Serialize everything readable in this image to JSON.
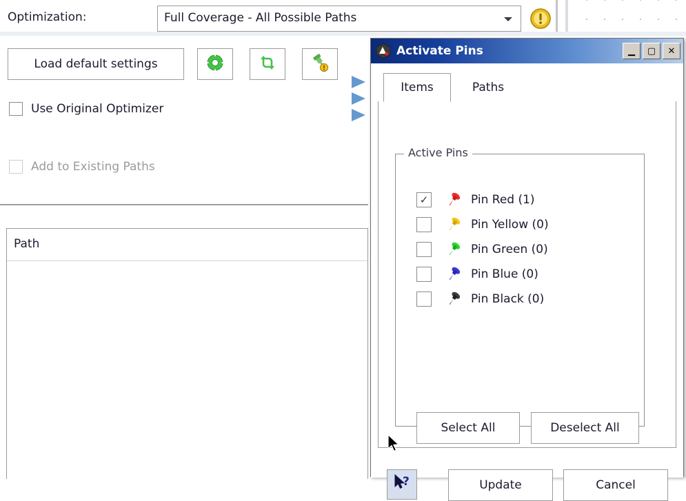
{
  "background": {
    "optimization": {
      "label": "Optimization:",
      "combo_value": "Full Coverage - All Possible Paths",
      "combo_arrow_icon": "chevron-down-icon",
      "warning_icon": "warning-exclamation-icon"
    },
    "toolbar": {
      "load_defaults_label": "Load default settings",
      "gear_icon": "gear-icon",
      "sync_icon": "sync-refresh-icon",
      "pin_icon": "pin-warning-icon",
      "ribbon_icon": "blue-chevron-icon"
    },
    "options": [
      {
        "label": "Use Original Optimizer",
        "checked": false,
        "disabled": false
      },
      {
        "label": "Add to Existing Paths",
        "checked": false,
        "disabled": true
      }
    ],
    "path_table": {
      "column_header": "Path",
      "rows": []
    }
  },
  "dialog": {
    "title": "Activate Pins",
    "app_icon": "app-hexagon-icon",
    "window_buttons": {
      "minimize": "_",
      "maximize": "□",
      "close": "✕",
      "minimize_name": "minimize-button",
      "maximize_name": "maximize-button",
      "close_name": "close-button"
    },
    "tabs": [
      {
        "label": "Items",
        "active": true
      },
      {
        "label": "Paths",
        "active": false
      }
    ],
    "group": {
      "legend": "Active Pins",
      "pins": [
        {
          "label": "Pin Red (1)",
          "checked": true,
          "color": "#ee2d2d",
          "icon": "pin-red-icon"
        },
        {
          "label": "Pin Yellow (0)",
          "checked": false,
          "color": "#f5c518",
          "icon": "pin-yellow-icon"
        },
        {
          "label": "Pin Green (0)",
          "checked": false,
          "color": "#2fd62f",
          "icon": "pin-green-icon"
        },
        {
          "label": "Pin Blue (0)",
          "checked": false,
          "color": "#3a36d8",
          "icon": "pin-blue-icon"
        },
        {
          "label": "Pin Black (0)",
          "checked": false,
          "color": "#3c3c3c",
          "icon": "pin-black-icon"
        }
      ],
      "select_all_label": "Select All",
      "deselect_all_label": "Deselect All"
    },
    "footer": {
      "help_icon": "whats-this-help-icon",
      "update_label": "Update",
      "cancel_label": "Cancel"
    },
    "checkmark_glyph": "✓"
  },
  "colors": {
    "titlebar_start": "#0a2a7a",
    "titlebar_end": "#b6cde8",
    "border": "#9a9a9a",
    "text": "#1b1b2f",
    "disabled_text": "#9b9b9b",
    "help_button_bg": "#d6dff0"
  }
}
